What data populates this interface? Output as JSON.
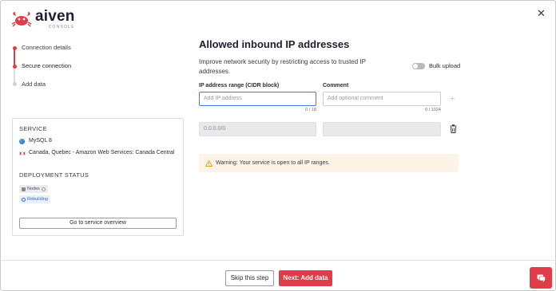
{
  "brand": {
    "name": "aiven",
    "sub": "CONSOLE",
    "accent": "#e03c4a"
  },
  "stepper": {
    "steps": [
      {
        "label": "Connection details",
        "state": "done"
      },
      {
        "label": "Secure connection",
        "state": "active"
      },
      {
        "label": "Add data",
        "state": "pending"
      }
    ]
  },
  "service_card": {
    "service_heading": "SERVICE",
    "service_name": "MySQL 8",
    "region": "Canada, Quebec - Amazon Web Services: Canada Central",
    "deployment_heading": "DEPLOYMENT STATUS",
    "nodes_label": "Nodes",
    "status_label": "Rebuilding",
    "overview_button": "Go to service overview"
  },
  "main": {
    "title": "Allowed inbound IP addresses",
    "description": "Improve network security by restricting access to trusted IP addresses.",
    "bulk_upload_label": "Bulk upload",
    "bulk_upload_enabled": false,
    "ip_label": "IP address range (CIDR block)",
    "ip_placeholder": "Add IP address",
    "ip_counter": "0 / 18",
    "comment_label": "Comment",
    "comment_placeholder": "Add optional comment",
    "comment_counter": "0 / 1024",
    "existing_ip": "0.0.0.0/0",
    "existing_comment": "",
    "warning": "Warning: Your service is open to all IP ranges."
  },
  "footer": {
    "skip_label": "Skip this step",
    "next_label": "Next: Add data"
  },
  "icons": {
    "close": "close-icon",
    "plus": "plus-icon",
    "trash": "trash-icon",
    "warning": "warning-icon",
    "chat": "chat-icon"
  }
}
